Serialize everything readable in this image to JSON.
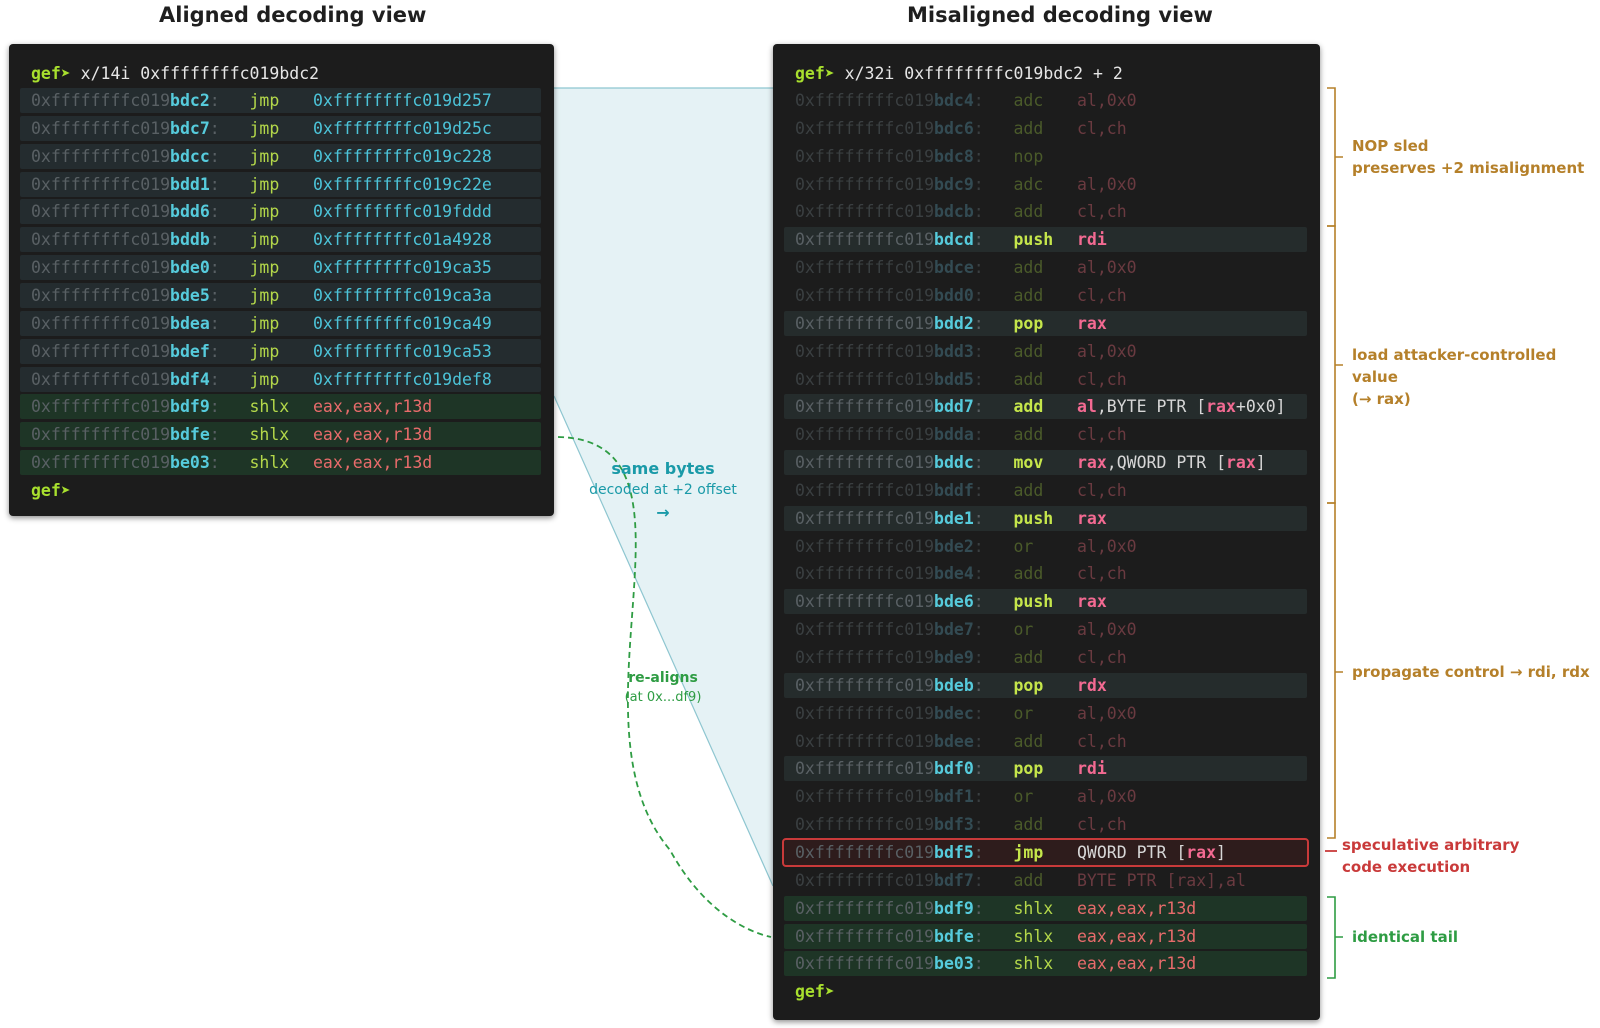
{
  "titles": {
    "aligned": "Aligned decoding view",
    "misaligned": "Misaligned decoding view"
  },
  "aligned": {
    "command_prompt": "gef➤",
    "command": " x/14i 0xffffffffc019bdc2",
    "end_prompt": "gef➤",
    "rows": [
      {
        "pre": "0xffffffffc019",
        "hi": "bdc2",
        "mn": "jmp",
        "op": "0xffffffffc019d257",
        "kind": "jmp"
      },
      {
        "pre": "0xffffffffc019",
        "hi": "bdc7",
        "mn": "jmp",
        "op": "0xffffffffc019d25c",
        "kind": "jmp"
      },
      {
        "pre": "0xffffffffc019",
        "hi": "bdcc",
        "mn": "jmp",
        "op": "0xffffffffc019c228",
        "kind": "jmp"
      },
      {
        "pre": "0xffffffffc019",
        "hi": "bdd1",
        "mn": "jmp",
        "op": "0xffffffffc019c22e",
        "kind": "jmp"
      },
      {
        "pre": "0xffffffffc019",
        "hi": "bdd6",
        "mn": "jmp",
        "op": "0xffffffffc019fddd",
        "kind": "jmp"
      },
      {
        "pre": "0xffffffffc019",
        "hi": "bddb",
        "mn": "jmp",
        "op": "0xffffffffc01a4928",
        "kind": "jmp"
      },
      {
        "pre": "0xffffffffc019",
        "hi": "bde0",
        "mn": "jmp",
        "op": "0xffffffffc019ca35",
        "kind": "jmp"
      },
      {
        "pre": "0xffffffffc019",
        "hi": "bde5",
        "mn": "jmp",
        "op": "0xffffffffc019ca3a",
        "kind": "jmp"
      },
      {
        "pre": "0xffffffffc019",
        "hi": "bdea",
        "mn": "jmp",
        "op": "0xffffffffc019ca49",
        "kind": "jmp"
      },
      {
        "pre": "0xffffffffc019",
        "hi": "bdef",
        "mn": "jmp",
        "op": "0xffffffffc019ca53",
        "kind": "jmp"
      },
      {
        "pre": "0xffffffffc019",
        "hi": "bdf4",
        "mn": "jmp",
        "op": "0xffffffffc019def8",
        "kind": "jmp"
      },
      {
        "pre": "0xffffffffc019",
        "hi": "bdf9",
        "mn": "shlx",
        "op": "eax,eax,r13d",
        "kind": "shlx"
      },
      {
        "pre": "0xffffffffc019",
        "hi": "bdfe",
        "mn": "shlx",
        "op": "eax,eax,r13d",
        "kind": "shlx"
      },
      {
        "pre": "0xffffffffc019",
        "hi": "be03",
        "mn": "shlx",
        "op": "eax,eax,r13d",
        "kind": "shlx"
      }
    ]
  },
  "misaligned": {
    "command_prompt": "gef➤",
    "command": " x/32i 0xffffffffc019bdc2 + 2",
    "end_prompt": "gef➤",
    "rows": [
      {
        "pre": "0xffffffffc019",
        "hi": "bdc4",
        "mn": "adc",
        "op": "al,0x0",
        "kind": "dim"
      },
      {
        "pre": "0xffffffffc019",
        "hi": "bdc6",
        "mn": "add",
        "op": "cl,ch",
        "kind": "dim"
      },
      {
        "pre": "0xffffffffc019",
        "hi": "bdc8",
        "mn": "nop",
        "op": "",
        "kind": "dim"
      },
      {
        "pre": "0xffffffffc019",
        "hi": "bdc9",
        "mn": "adc",
        "op": "al,0x0",
        "kind": "dim"
      },
      {
        "pre": "0xffffffffc019",
        "hi": "bdcb",
        "mn": "add",
        "op": "cl,ch",
        "kind": "dim"
      },
      {
        "pre": "0xffffffffc019",
        "hi": "bdcd",
        "mn": "push",
        "op": "rdi",
        "kind": "key"
      },
      {
        "pre": "0xffffffffc019",
        "hi": "bdce",
        "mn": "add",
        "op": "al,0x0",
        "kind": "dim"
      },
      {
        "pre": "0xffffffffc019",
        "hi": "bdd0",
        "mn": "add",
        "op": "cl,ch",
        "kind": "dim"
      },
      {
        "pre": "0xffffffffc019",
        "hi": "bdd2",
        "mn": "pop",
        "op": "rax",
        "kind": "key"
      },
      {
        "pre": "0xffffffffc019",
        "hi": "bdd3",
        "mn": "add",
        "op": "al,0x0",
        "kind": "dim"
      },
      {
        "pre": "0xffffffffc019",
        "hi": "bdd5",
        "mn": "add",
        "op": "cl,ch",
        "kind": "dim"
      },
      {
        "pre": "0xffffffffc019",
        "hi": "bdd7",
        "mn": "add",
        "op": "al",
        "op2": ",BYTE PTR [",
        "op3": "rax",
        "op4": "+0x0]",
        "kind": "key"
      },
      {
        "pre": "0xffffffffc019",
        "hi": "bdda",
        "mn": "add",
        "op": "cl,ch",
        "kind": "dim"
      },
      {
        "pre": "0xffffffffc019",
        "hi": "bddc",
        "mn": "mov",
        "op": "rax",
        "op2": ",QWORD PTR [",
        "op3": "rax",
        "op4": "]",
        "kind": "key"
      },
      {
        "pre": "0xffffffffc019",
        "hi": "bddf",
        "mn": "add",
        "op": "cl,ch",
        "kind": "dim"
      },
      {
        "pre": "0xffffffffc019",
        "hi": "bde1",
        "mn": "push",
        "op": "rax",
        "kind": "key"
      },
      {
        "pre": "0xffffffffc019",
        "hi": "bde2",
        "mn": "or",
        "op": "al,0x0",
        "kind": "dim"
      },
      {
        "pre": "0xffffffffc019",
        "hi": "bde4",
        "mn": "add",
        "op": "cl,ch",
        "kind": "dim"
      },
      {
        "pre": "0xffffffffc019",
        "hi": "bde6",
        "mn": "push",
        "op": "rax",
        "kind": "key"
      },
      {
        "pre": "0xffffffffc019",
        "hi": "bde7",
        "mn": "or",
        "op": "al,0x0",
        "kind": "dim"
      },
      {
        "pre": "0xffffffffc019",
        "hi": "bde9",
        "mn": "add",
        "op": "cl,ch",
        "kind": "dim"
      },
      {
        "pre": "0xffffffffc019",
        "hi": "bdeb",
        "mn": "pop",
        "op": "rdx",
        "kind": "key"
      },
      {
        "pre": "0xffffffffc019",
        "hi": "bdec",
        "mn": "or",
        "op": "al,0x0",
        "kind": "dim"
      },
      {
        "pre": "0xffffffffc019",
        "hi": "bdee",
        "mn": "add",
        "op": "cl,ch",
        "kind": "dim"
      },
      {
        "pre": "0xffffffffc019",
        "hi": "bdf0",
        "mn": "pop",
        "op": "rdi",
        "kind": "key"
      },
      {
        "pre": "0xffffffffc019",
        "hi": "bdf1",
        "mn": "or",
        "op": "al,0x0",
        "kind": "dim"
      },
      {
        "pre": "0xffffffffc019",
        "hi": "bdf3",
        "mn": "add",
        "op": "cl,ch",
        "kind": "dim"
      },
      {
        "pre": "0xffffffffc019",
        "hi": "bdf5",
        "mn": "jmp",
        "op": "QWORD PTR [",
        "op3": "rax",
        "op4": "]",
        "kind": "crit"
      },
      {
        "pre": "0xffffffffc019",
        "hi": "bdf7",
        "mn": "add",
        "op": "BYTE PTR [rax],al",
        "kind": "dim"
      },
      {
        "pre": "0xffffffffc019",
        "hi": "bdf9",
        "mn": "shlx",
        "op": "eax,eax,r13d",
        "kind": "shlx"
      },
      {
        "pre": "0xffffffffc019",
        "hi": "bdfe",
        "mn": "shlx",
        "op": "eax,eax,r13d",
        "kind": "shlx"
      },
      {
        "pre": "0xffffffffc019",
        "hi": "be03",
        "mn": "shlx",
        "op": "eax,eax,r13d",
        "kind": "shlx"
      }
    ]
  },
  "annotations": {
    "nop_sled": [
      "NOP sled",
      "preserves +2 misalignment"
    ],
    "load": [
      "load attacker-controlled value",
      "(→ rax)"
    ],
    "propagate": "propagate control → rdi, rdx",
    "speculative": [
      "speculative arbitrary",
      "code execution"
    ],
    "tail": "identical tail"
  },
  "middle": {
    "same_bytes_title": "same bytes",
    "same_bytes_sub": "decoded at +2 offset",
    "same_bytes_arrow": "→",
    "realigns_title": "re-aligns",
    "realigns_sub": "(at 0x...df9)"
  },
  "colors": {
    "terminal_bg": "#1c1c1c",
    "address_hi": "#56cbdc",
    "mnemonic": "#b4d84a",
    "register": "#e86b6b",
    "key_register": "#f36a92",
    "brown_note": "#b5802a",
    "red_note": "#c93a3a",
    "green_note": "#2e9c43",
    "teal_note": "#1a9aa8",
    "band_fill": "#cfe8ec"
  }
}
